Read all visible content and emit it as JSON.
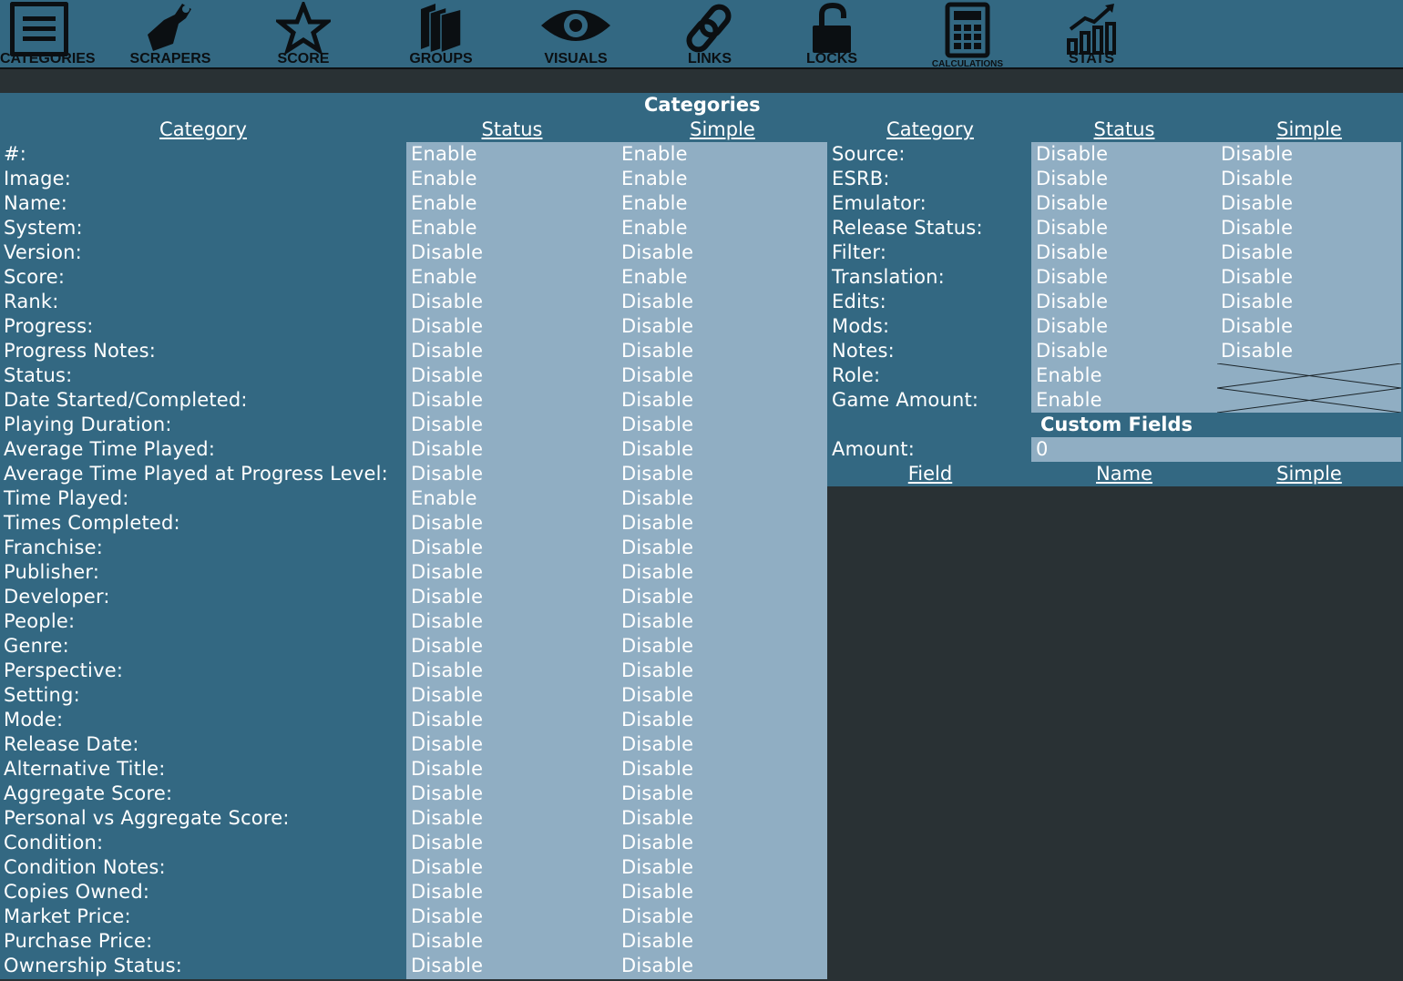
{
  "toolbar": [
    {
      "label": "CATEGORIES",
      "icon": "list-icon"
    },
    {
      "label": "SCRAPERS",
      "icon": "scraper-icon"
    },
    {
      "label": "SCORE",
      "icon": "star-icon"
    },
    {
      "label": "GROUPS",
      "icon": "books-icon"
    },
    {
      "label": "VISUALS",
      "icon": "eye-icon"
    },
    {
      "label": "LINKS",
      "icon": "link-icon"
    },
    {
      "label": "LOCKS",
      "icon": "lock-icon"
    },
    {
      "label": "CALCULATIONS",
      "icon": "calculator-icon"
    },
    {
      "label": "STATS",
      "icon": "stats-icon"
    }
  ],
  "section_title": "Categories",
  "left_table": {
    "headers": [
      "Category",
      "Status",
      "Simple"
    ],
    "rows": [
      {
        "category": "#:",
        "status": "Enable",
        "simple": "Enable"
      },
      {
        "category": "Image:",
        "status": "Enable",
        "simple": "Enable"
      },
      {
        "category": "Name:",
        "status": "Enable",
        "simple": "Enable"
      },
      {
        "category": "System:",
        "status": "Enable",
        "simple": "Enable"
      },
      {
        "category": "Version:",
        "status": "Disable",
        "simple": "Disable"
      },
      {
        "category": "Score:",
        "status": "Enable",
        "simple": "Enable"
      },
      {
        "category": "Rank:",
        "status": "Disable",
        "simple": "Disable"
      },
      {
        "category": "Progress:",
        "status": "Disable",
        "simple": "Disable"
      },
      {
        "category": "Progress Notes:",
        "status": "Disable",
        "simple": "Disable"
      },
      {
        "category": "Status:",
        "status": "Disable",
        "simple": "Disable"
      },
      {
        "category": "Date Started/Completed:",
        "status": "Disable",
        "simple": "Disable"
      },
      {
        "category": "Playing Duration:",
        "status": "Disable",
        "simple": "Disable"
      },
      {
        "category": "Average Time Played:",
        "status": "Disable",
        "simple": "Disable"
      },
      {
        "category": "Average Time Played at Progress Level:",
        "status": "Disable",
        "simple": "Disable"
      },
      {
        "category": "Time Played:",
        "status": "Enable",
        "simple": "Disable"
      },
      {
        "category": "Times Completed:",
        "status": "Disable",
        "simple": "Disable"
      },
      {
        "category": "Franchise:",
        "status": "Disable",
        "simple": "Disable"
      },
      {
        "category": "Publisher:",
        "status": "Disable",
        "simple": "Disable"
      },
      {
        "category": "Developer:",
        "status": "Disable",
        "simple": "Disable"
      },
      {
        "category": "People:",
        "status": "Disable",
        "simple": "Disable"
      },
      {
        "category": "Genre:",
        "status": "Disable",
        "simple": "Disable"
      },
      {
        "category": "Perspective:",
        "status": "Disable",
        "simple": "Disable"
      },
      {
        "category": "Setting:",
        "status": "Disable",
        "simple": "Disable"
      },
      {
        "category": "Mode:",
        "status": "Disable",
        "simple": "Disable"
      },
      {
        "category": "Release Date:",
        "status": "Disable",
        "simple": "Disable"
      },
      {
        "category": "Alternative Title:",
        "status": "Disable",
        "simple": "Disable"
      },
      {
        "category": "Aggregate Score:",
        "status": "Disable",
        "simple": "Disable"
      },
      {
        "category": "Personal vs Aggregate Score:",
        "status": "Disable",
        "simple": "Disable"
      },
      {
        "category": "Condition:",
        "status": "Disable",
        "simple": "Disable"
      },
      {
        "category": "Condition Notes:",
        "status": "Disable",
        "simple": "Disable"
      },
      {
        "category": "Copies Owned:",
        "status": "Disable",
        "simple": "Disable"
      },
      {
        "category": "Market Price:",
        "status": "Disable",
        "simple": "Disable"
      },
      {
        "category": "Purchase Price:",
        "status": "Disable",
        "simple": "Disable"
      },
      {
        "category": "Ownership Status:",
        "status": "Disable",
        "simple": "Disable"
      }
    ]
  },
  "right_table": {
    "headers": [
      "Category",
      "Status",
      "Simple"
    ],
    "rows": [
      {
        "category": "Source:",
        "status": "Disable",
        "simple": "Disable"
      },
      {
        "category": "ESRB:",
        "status": "Disable",
        "simple": "Disable"
      },
      {
        "category": "Emulator:",
        "status": "Disable",
        "simple": "Disable"
      },
      {
        "category": "Release Status:",
        "status": "Disable",
        "simple": "Disable"
      },
      {
        "category": "Filter:",
        "status": "Disable",
        "simple": "Disable"
      },
      {
        "category": "Translation:",
        "status": "Disable",
        "simple": "Disable"
      },
      {
        "category": "Edits:",
        "status": "Disable",
        "simple": "Disable"
      },
      {
        "category": "Mods:",
        "status": "Disable",
        "simple": "Disable"
      },
      {
        "category": "Notes:",
        "status": "Disable",
        "simple": "Disable"
      },
      {
        "category": "Role:",
        "status": "Enable",
        "simple": ""
      },
      {
        "category": "Game Amount:",
        "status": "Enable",
        "simple": ""
      }
    ]
  },
  "custom_fields": {
    "title": "Custom Fields",
    "amount_label": "Amount:",
    "amount_value": "0",
    "headers": [
      "Field",
      "Name",
      "Simple"
    ]
  },
  "colors": {
    "panel": "#336882",
    "cell_light": "#90aec3",
    "background": "#293134",
    "icon": "#0b0f12"
  }
}
